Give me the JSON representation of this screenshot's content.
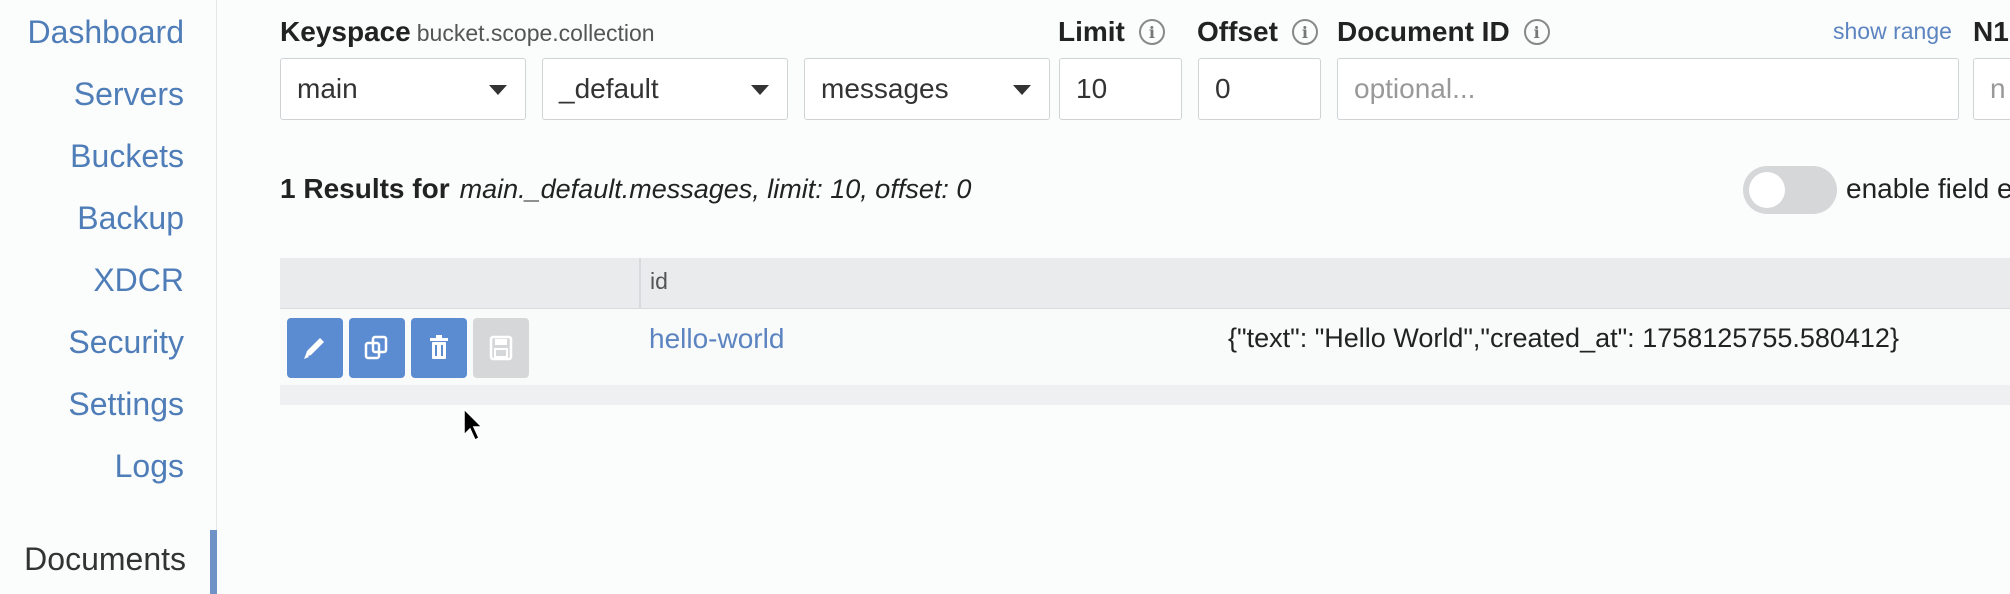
{
  "sidebar": {
    "items": [
      {
        "label": "Dashboard"
      },
      {
        "label": "Servers"
      },
      {
        "label": "Buckets"
      },
      {
        "label": "Backup"
      },
      {
        "label": "XDCR"
      },
      {
        "label": "Security"
      },
      {
        "label": "Settings"
      },
      {
        "label": "Logs"
      },
      {
        "label": "Documents"
      }
    ],
    "active": "Documents"
  },
  "filters": {
    "keyspace_label": "Keyspace",
    "keyspace_hint": "bucket.scope.collection",
    "bucket_value": "main",
    "scope_value": "_default",
    "collection_value": "messages",
    "limit_label": "Limit",
    "limit_value": "10",
    "offset_label": "Offset",
    "offset_value": "0",
    "docid_label": "Document ID",
    "docid_placeholder": "optional...",
    "show_range": "show range",
    "n1ql_label": "N1",
    "n1ql_placeholder": "n"
  },
  "results": {
    "count_text": "1 Results for",
    "description": "main._default.messages, limit: 10, offset: 0",
    "toggle_label": "enable field e",
    "toggle_on": false
  },
  "table": {
    "columns": [
      "id"
    ],
    "rows": [
      {
        "id": "hello-world",
        "content": "{\"text\": \"Hello World\",\"created_at\": 1758125755.580412}"
      }
    ]
  },
  "colors": {
    "accent": "#5b8bd0",
    "link": "#4f7db8",
    "disabled": "#d6d7d9"
  },
  "icons": [
    "pencil-icon",
    "copy-icon",
    "trash-icon",
    "save-icon",
    "info-icon",
    "caret-down-icon",
    "mouse-pointer-icon"
  ]
}
